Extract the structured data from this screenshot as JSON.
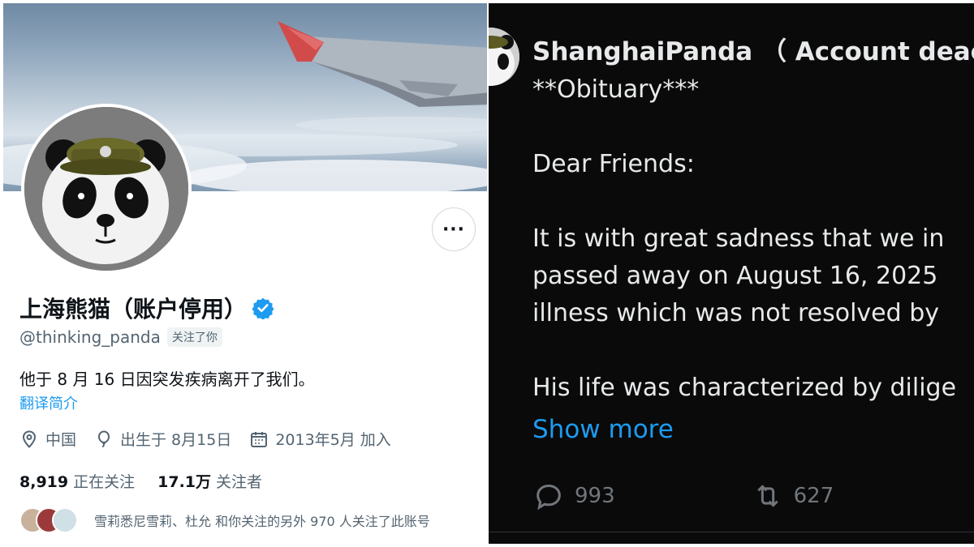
{
  "profile": {
    "display_name": "上海熊猫（账户停用）",
    "handle": "@thinking_panda",
    "follows_you": "关注了你",
    "bio": "他于 8 月 16 日因突发疾病离开了我们。",
    "translate_bio": "翻译简介",
    "location": "中国",
    "birthday": "出生于 8月15日",
    "joined": "2013年5月 加入",
    "following_count": "8,919",
    "following_label": "正在关注",
    "followers_count": "17.1万",
    "followers_label": "关注者",
    "followed_by_text": "雪莉悉尼雪莉、杜允 和你关注的另外 970 人关注了此账号",
    "more_button": "···",
    "icons": {
      "verified": "verified-badge-icon",
      "location": "location-pin-icon",
      "birthday": "balloon-icon",
      "joined": "calendar-icon"
    },
    "colors": {
      "accent": "#1d9bf0",
      "secondary_text": "#536471",
      "primary_text": "#0f1419"
    }
  },
  "post": {
    "author": "ShanghaiPanda （ Account deac",
    "text": "**Obituary***\n\nDear Friends:\n\nIt is with great sadness that we in\npassed away on August 16, 2025\nillness which was not resolved by\n\nHis life was characterized by dilige",
    "show_more": "Show more",
    "replies": "993",
    "reposts": "627",
    "colors": {
      "background": "#0a0a0a",
      "text": "#e7e9ea",
      "link": "#1d9bf0",
      "muted": "#71767b"
    }
  }
}
